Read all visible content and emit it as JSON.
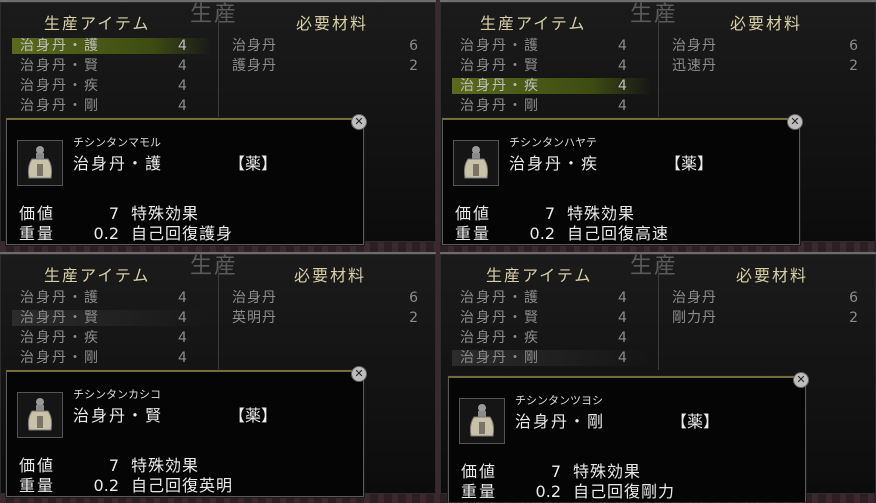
{
  "header": {
    "watermark": "生産",
    "col_items": "生産アイテム",
    "col_materials": "必要材料"
  },
  "labels": {
    "value": "価値",
    "weight": "重量",
    "category": "【薬】"
  },
  "panels": [
    {
      "items": [
        {
          "name": "治身丹・護",
          "qty": "4"
        },
        {
          "name": "治身丹・賢",
          "qty": "4"
        },
        {
          "name": "治身丹・疾",
          "qty": "4"
        },
        {
          "name": "治身丹・剛",
          "qty": "4"
        }
      ],
      "selected_index": 0,
      "materials": [
        {
          "name": "治身丹",
          "qty": "6"
        },
        {
          "name": "護身丹",
          "qty": "2"
        }
      ],
      "popup": {
        "kana": "チシンタンマモル",
        "name": "治身丹・護",
        "value": "7",
        "effect_label": "特殊効果",
        "weight": "0.2",
        "effect": "自己回復護身"
      }
    },
    {
      "items": [
        {
          "name": "治身丹・護",
          "qty": "4"
        },
        {
          "name": "治身丹・賢",
          "qty": "4"
        },
        {
          "name": "治身丹・疾",
          "qty": "4"
        },
        {
          "name": "治身丹・剛",
          "qty": "4"
        }
      ],
      "selected_index": 2,
      "materials": [
        {
          "name": "治身丹",
          "qty": "6"
        },
        {
          "name": "迅速丹",
          "qty": "2"
        }
      ],
      "popup": {
        "kana": "チシンタンハヤテ",
        "name": "治身丹・疾",
        "value": "7",
        "effect_label": "特殊効果",
        "weight": "0.2",
        "effect": "自己回復高速"
      }
    },
    {
      "items": [
        {
          "name": "治身丹・護",
          "qty": "4"
        },
        {
          "name": "治身丹・賢",
          "qty": "4"
        },
        {
          "name": "治身丹・疾",
          "qty": "4"
        },
        {
          "name": "治身丹・剛",
          "qty": "4"
        }
      ],
      "selected_index": 1,
      "materials": [
        {
          "name": "治身丹",
          "qty": "6"
        },
        {
          "name": "英明丹",
          "qty": "2"
        }
      ],
      "popup": {
        "kana": "チシンタンカシコ",
        "name": "治身丹・賢",
        "value": "7",
        "effect_label": "特殊効果",
        "weight": "0.2",
        "effect": "自己回復英明"
      }
    },
    {
      "items": [
        {
          "name": "治身丹・護",
          "qty": "4"
        },
        {
          "name": "治身丹・賢",
          "qty": "4"
        },
        {
          "name": "治身丹・疾",
          "qty": "4"
        },
        {
          "name": "治身丹・剛",
          "qty": "4"
        }
      ],
      "selected_index": 3,
      "materials": [
        {
          "name": "治身丹",
          "qty": "6"
        },
        {
          "name": "剛力丹",
          "qty": "2"
        }
      ],
      "popup": {
        "kana": "チシンタンツヨシ",
        "name": "治身丹・剛",
        "value": "7",
        "effect_label": "特殊効果",
        "weight": "0.2",
        "effect": "自己回復剛力"
      }
    }
  ],
  "icons": {
    "close": "close-icon",
    "item": "potion-bottle-icon"
  }
}
